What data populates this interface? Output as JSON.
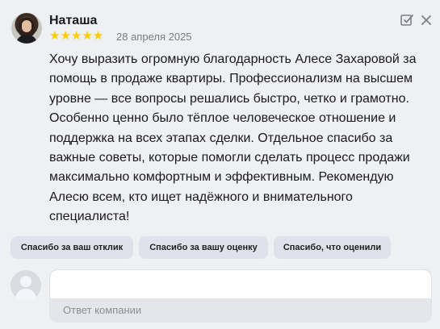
{
  "review": {
    "author": "Наташа",
    "rating_stars": "★★★★★",
    "rating": 5,
    "date": "28 апреля 2025",
    "text": "Хочу выразить огромную благодарность Алесе Захаровой за помощь в продаже квартиры. Профессионализм на высшем уровне — все вопросы решались быстро, четко и грамотно. Особенно ценно было тёплое человеческое отношение и поддержка на всех этапах сделки. Отдельное спасибо за важные советы, которые помогли сделать процесс продажи максимально комфортным и эффективным. Рекомендую Алесю всем, кто ищет надёжного и внимательного специалиста!"
  },
  "quick_replies": [
    {
      "label": "Спасибо за ваш отклик"
    },
    {
      "label": "Спасибо за вашу оценку"
    },
    {
      "label": "Спасибо, что оценили"
    }
  ],
  "reply": {
    "value": "",
    "label": "Ответ компании"
  },
  "colors": {
    "background": "#eff0f4",
    "star": "#ffcc00",
    "chip": "#dfe2ea",
    "muted_text": "#7a7b80"
  },
  "icons": {
    "edit": "edit-checkbox-icon",
    "close": "close-icon"
  }
}
